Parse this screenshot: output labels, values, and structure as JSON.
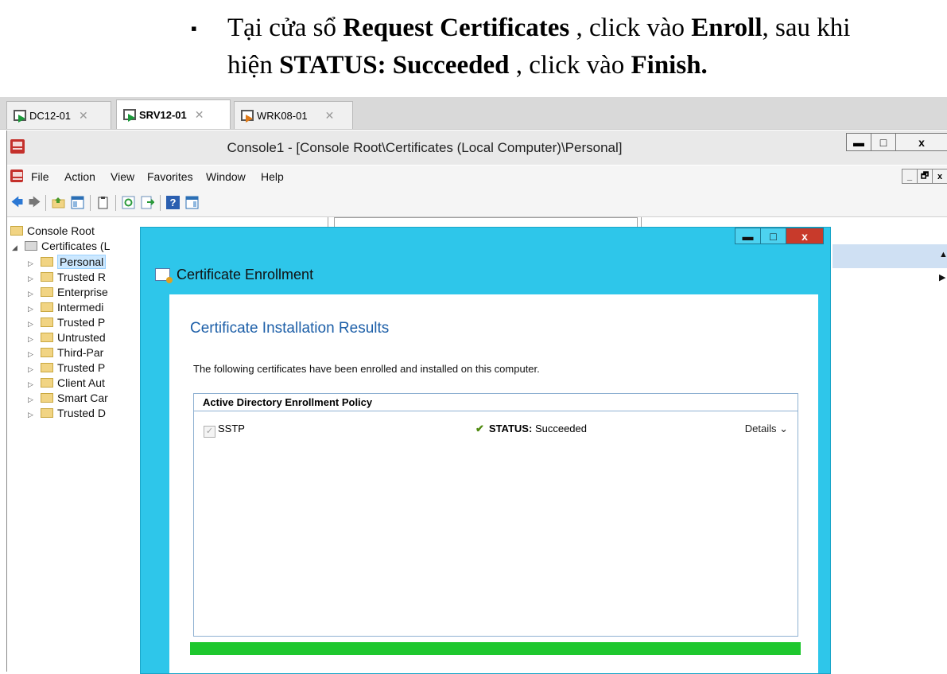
{
  "instruction": {
    "bullet": "▪",
    "line1_prefix": "Tại cửa sổ ",
    "line1_bold1": "Request Certificates",
    "line1_mid": " , click vào ",
    "line1_bold2": "Enroll",
    "line1_suffix": ", sau khi",
    "line2_prefix": "hiện ",
    "line2_bold1": "STATUS: Succeeded",
    "line2_mid": " , click vào ",
    "line2_bold2": "Finish."
  },
  "vm_tabs": [
    {
      "label": "DC12-01",
      "close": "✕",
      "icon": "vm-running-icon"
    },
    {
      "label": "SRV12-01",
      "close": "✕",
      "icon": "vm-running-icon",
      "active": true
    },
    {
      "label": "WRK08-01",
      "close": "✕",
      "icon": "vm-paused-icon"
    }
  ],
  "mmc": {
    "title": "Console1 - [Console Root\\Certificates (Local Computer)\\Personal]",
    "window_buttons": {
      "minimize": "▬",
      "maximize": "□",
      "close": "x"
    },
    "menu": [
      "File",
      "Action",
      "View",
      "Favorites",
      "Window",
      "Help"
    ],
    "mdi_buttons": {
      "minimize": "_",
      "restore": "🗗",
      "close": "x"
    },
    "tree": {
      "root": "Console Root",
      "certificates": "Certificates (L",
      "stores": [
        "Personal",
        "Trusted R",
        "Enterprise",
        "Intermedi",
        "Trusted P",
        "Untrusted",
        "Third-Par",
        "Trusted P",
        "Client Aut",
        "Smart Car",
        "Trusted D"
      ]
    },
    "right_scroll_up": "▲",
    "right_more": "▶"
  },
  "dialog": {
    "title": "Certificate Enrollment",
    "window_buttons": {
      "minimize": "▬",
      "maximize": "□",
      "close": "x"
    },
    "heading": "Certificate Installation Results",
    "description": "The following certificates have been enrolled and installed on this computer.",
    "policy_header": "Active Directory Enrollment Policy",
    "item": {
      "name": "SSTP",
      "checked": true,
      "check_glyph": "✓",
      "status_icon": "✔",
      "status_label": "STATUS:",
      "status_value": "Succeeded",
      "details": "Details ⌄"
    },
    "progress_fraction": 1.0,
    "progress_color": "#1ec72e"
  }
}
